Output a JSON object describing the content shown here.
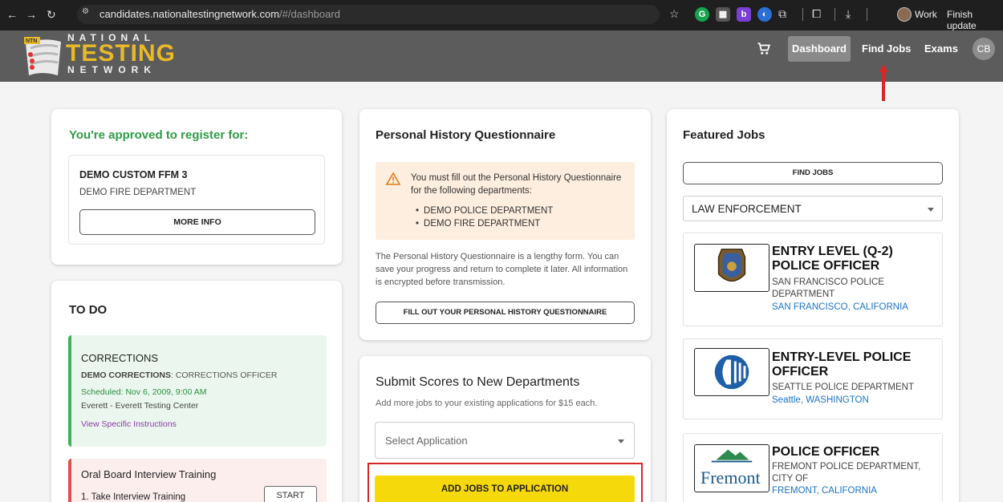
{
  "browser": {
    "url_host": "candidates.nationaltestingnetwork.com",
    "url_path": "/#/dashboard",
    "profile_label": "Work",
    "update_label": "Finish update"
  },
  "header": {
    "logo": {
      "top": "NATIONAL",
      "main": "TESTING",
      "bottom": "NETWORK",
      "badge": "NTN"
    },
    "nav": {
      "dashboard": "Dashboard",
      "find_jobs": "Find Jobs",
      "exams": "Exams"
    },
    "avatar_initials": "CB",
    "accent_color": "#e8b928",
    "bar_color": "#5c5c5c"
  },
  "approved": {
    "title": "You're approved to register for:",
    "item": {
      "name": "DEMO CUSTOM FFM 3",
      "department": "DEMO FIRE DEPARTMENT",
      "button": "MORE INFO"
    }
  },
  "todo": {
    "title": "TO DO",
    "items": [
      {
        "category": "CORRECTIONS",
        "agency": "DEMO CORRECTIONS",
        "position": ": CORRECTIONS OFFICER",
        "scheduled": "Scheduled: Nov 6, 2009, 9:00 AM",
        "location": "Everett - Everett Testing Center",
        "link": "View Specific Instructions",
        "color": "#3cb35a"
      },
      {
        "category": "Oral Board Interview Training",
        "step": "1. Take Interview Training",
        "button": "START",
        "color": "#d9534f"
      }
    ]
  },
  "phq": {
    "title": "Personal History Questionnaire",
    "warning": "You must fill out the Personal History Questionnaire for the following departments:",
    "departments": [
      "DEMO POLICE DEPARTMENT",
      "DEMO FIRE DEPARTMENT"
    ],
    "description": "The Personal History Questionnaire is a lengthy form. You can save your progress and return to complete it later. All information is encrypted before transmission.",
    "button": "FILL OUT YOUR PERSONAL HISTORY QUESTIONNAIRE"
  },
  "submit": {
    "title": "Submit Scores to New Departments",
    "description": "Add more jobs to your existing applications for $15 each.",
    "select_placeholder": "Select Application",
    "button": "ADD JOBS TO APPLICATION",
    "button_color": "#f5d90a"
  },
  "featured": {
    "title": "Featured Jobs",
    "find_button": "FIND JOBS",
    "category": "LAW ENFORCEMENT",
    "jobs": [
      {
        "title": "ENTRY LEVEL (Q-2) POLICE OFFICER",
        "department": "SAN FRANCISCO POLICE DEPARTMENT",
        "location": "SAN FRANCISCO, CALIFORNIA"
      },
      {
        "title": "ENTRY-LEVEL POLICE OFFICER",
        "department": "SEATTLE POLICE DEPARTMENT",
        "location": "Seattle, WASHINGTON"
      },
      {
        "title": "POLICE OFFICER",
        "department": "FREMONT POLICE DEPARTMENT, CITY OF",
        "location": "FREMONT, CALIFORNIA",
        "logo_word": "Fremont"
      }
    ]
  }
}
